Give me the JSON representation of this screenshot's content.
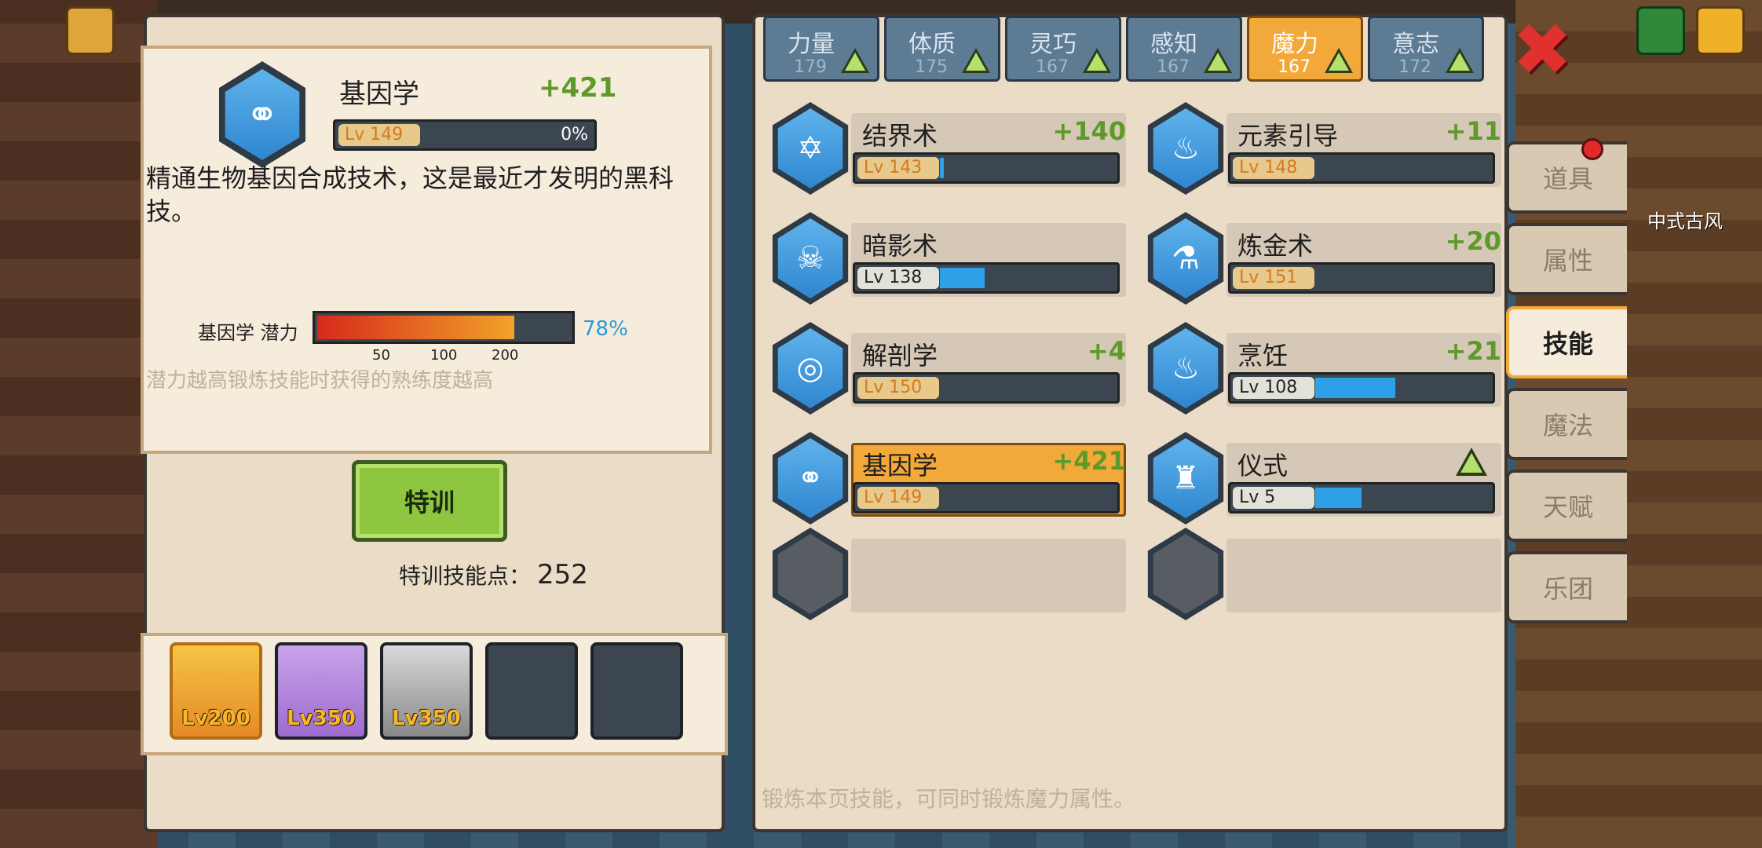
{
  "selected_skill": {
    "name": "基因学",
    "bonus": "+421",
    "level": "Lv 149",
    "progress": "0%",
    "progress_value": 0,
    "description": "精通生物基因合成技术，这是最近才发明的黑科技。",
    "potential_label": "基因学 潜力",
    "potential_percent": "78%",
    "potential_value": 0.78,
    "ticks": [
      "50",
      "100",
      "200"
    ],
    "potential_note": "潜力越高锻炼技能时获得的熟练度越高"
  },
  "train": {
    "button_label": "特训",
    "points_label": "特训技能点：",
    "points_value": "252"
  },
  "party": [
    {
      "level": "Lv200"
    },
    {
      "level": "Lv350"
    },
    {
      "level": "Lv350"
    }
  ],
  "tabs": [
    {
      "name": "力量",
      "value": "179"
    },
    {
      "name": "体质",
      "value": "175"
    },
    {
      "name": "灵巧",
      "value": "167"
    },
    {
      "name": "感知",
      "value": "167"
    },
    {
      "name": "魔力",
      "value": "167"
    },
    {
      "name": "意志",
      "value": "172"
    }
  ],
  "skills": [
    {
      "name": "结界术",
      "bonus": "+140",
      "level": "Lv 143",
      "fill": 0.02,
      "icon": "hexagram-icon"
    },
    {
      "name": "元素引导",
      "bonus": "+11",
      "level": "Lv 148",
      "fill": 0.0,
      "icon": "spiral-icon"
    },
    {
      "name": "暗影术",
      "bonus": "",
      "level": "Lv 138",
      "fill": 0.25,
      "icon": "skull-flame-icon"
    },
    {
      "name": "炼金术",
      "bonus": "+20",
      "level": "Lv 151",
      "fill": 0.0,
      "icon": "flask-icon"
    },
    {
      "name": "解剖学",
      "bonus": "+4",
      "level": "Lv 150",
      "fill": 0.0,
      "icon": "meat-icon"
    },
    {
      "name": "烹饪",
      "bonus": "+21",
      "level": "Lv 108",
      "fill": 0.45,
      "icon": "pot-icon"
    },
    {
      "name": "基因学",
      "bonus": "+421",
      "level": "Lv 149",
      "fill": 0.0,
      "icon": "molecule-icon"
    },
    {
      "name": "仪式",
      "bonus": "",
      "level": "Lv 5",
      "fill": 0.26,
      "icon": "candle-icon"
    }
  ],
  "footer_note": "锻炼本页技能，可同时锻炼魔力属性。",
  "side_menu": [
    "道具",
    "属性",
    "技能",
    "魔法",
    "天赋",
    "乐团"
  ],
  "right_label": "中式古风"
}
